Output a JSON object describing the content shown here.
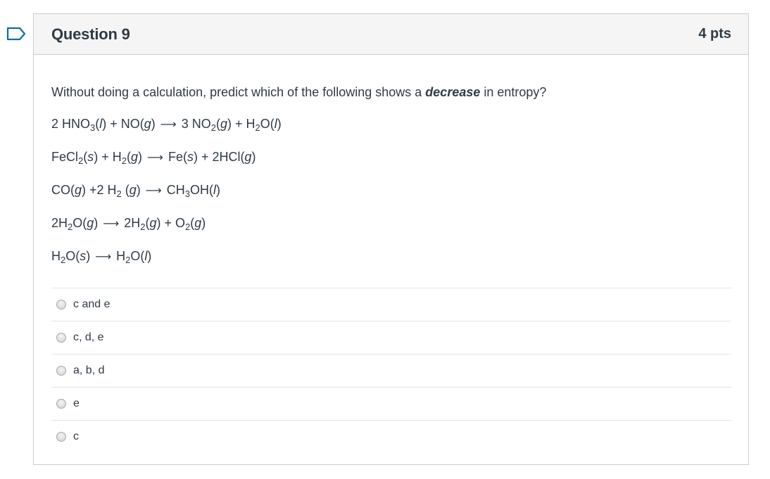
{
  "question": {
    "title": "Question 9",
    "points": "4 pts",
    "prompt_before": "Without doing a calculation, predict which of the following shows a ",
    "prompt_emphasis": "decrease",
    "prompt_after": " in entropy?"
  },
  "equations": [
    "2 HNO3(l) + NO(g) → 3 NO2(g) + H2O(l)",
    "FeCl2(s) + H2(g) → Fe(s) + 2HCl(g)",
    "CO(g) +2 H2 (g) → CH3OH(l)",
    "2H2O(g) → 2H2(g) + O2(g)",
    "H2O(s) → H2O(l)"
  ],
  "answers": [
    {
      "label": "c and e"
    },
    {
      "label": "c, d, e"
    },
    {
      "label": "a, b, d"
    },
    {
      "label": "e"
    },
    {
      "label": "c"
    }
  ],
  "colors": {
    "flag_outline": "#0770a3",
    "header_bg": "#f5f5f5",
    "border": "#c7cdd1",
    "text": "#2d3b45"
  },
  "icons": {
    "flag": "bookmark-flag-icon"
  }
}
